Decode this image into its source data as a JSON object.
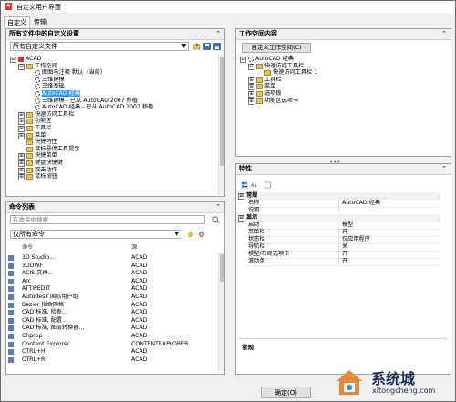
{
  "window": {
    "title": "自定义用户界面"
  },
  "tabs": [
    {
      "label": "自定义"
    },
    {
      "label": "传输"
    }
  ],
  "left_top": {
    "header": "所有文件中的自定义设置",
    "collapse": "⌃",
    "file_dropdown": "所有自定义文件",
    "tree": [
      {
        "label": "ACAD",
        "depth": 0,
        "exp": "⊟",
        "icon": "acad-icon"
      },
      {
        "label": "工作空间",
        "depth": 1,
        "exp": "⊟",
        "icon": "folder-icon"
      },
      {
        "label": "图图与注释 默认（当前）",
        "depth": 2,
        "exp": "",
        "icon": "gear-icon"
      },
      {
        "label": "三维建模",
        "depth": 2,
        "exp": "",
        "icon": "gear-icon"
      },
      {
        "label": "三维基础",
        "depth": 2,
        "exp": "",
        "icon": "gear-icon"
      },
      {
        "label": "AutoCAD 经典",
        "depth": 2,
        "exp": "",
        "icon": "gear-icon",
        "selected": true
      },
      {
        "label": "三维建模 - 已从 AutoCAD 2007 移植",
        "depth": 2,
        "exp": "",
        "icon": "gear-icon"
      },
      {
        "label": "AutoCAD 经典 - 已从 AutoCAD 2007 移植",
        "depth": 2,
        "exp": "",
        "icon": "gear-icon"
      },
      {
        "label": "快速访问工具栏",
        "depth": 1,
        "exp": "⊞",
        "icon": "folder-icon"
      },
      {
        "label": "功能区",
        "depth": 1,
        "exp": "⊞",
        "icon": "folder-icon"
      },
      {
        "label": "工具栏",
        "depth": 1,
        "exp": "⊞",
        "icon": "folder-icon"
      },
      {
        "label": "菜单",
        "depth": 1,
        "exp": "⊞",
        "icon": "folder-icon"
      },
      {
        "label": "快捷特性",
        "depth": 1,
        "exp": "",
        "icon": "folder-icon"
      },
      {
        "label": "鼠标悬停工具提示",
        "depth": 1,
        "exp": "",
        "icon": "folder-icon"
      },
      {
        "label": "快捷菜单",
        "depth": 1,
        "exp": "⊞",
        "icon": "folder-icon"
      },
      {
        "label": "键盘快捷键",
        "depth": 1,
        "exp": "⊞",
        "icon": "folder-icon"
      },
      {
        "label": "双击动作",
        "depth": 1,
        "exp": "⊞",
        "icon": "folder-icon"
      },
      {
        "label": "鼠标按钮",
        "depth": 1,
        "exp": "⊞",
        "icon": "folder-icon"
      }
    ]
  },
  "left_bottom": {
    "header": "命令列表:",
    "collapse": "⌃",
    "search_placeholder": "在命令中搜索",
    "filter_dropdown": "仅所有命令",
    "columns": {
      "command": "命令",
      "source": "源"
    },
    "commands": [
      {
        "name": "3D Studio...",
        "source": "ACAD"
      },
      {
        "name": "3DDWF",
        "source": "ACAD"
      },
      {
        "name": "ACIS 文件...",
        "source": "ACAD"
      },
      {
        "name": "Arc",
        "source": "ACAD"
      },
      {
        "name": "ATTIPEDIT",
        "source": "ACAD"
      },
      {
        "name": "Autodesk 国际用户组",
        "source": "ACAD"
      },
      {
        "name": "Bezier 拟合网格",
        "source": "ACAD"
      },
      {
        "name": "CAD 标准, 检查...",
        "source": "ACAD"
      },
      {
        "name": "CAD 标准, 配置...",
        "source": "ACAD"
      },
      {
        "name": "CAD 标准, 图层转换器...",
        "source": "ACAD"
      },
      {
        "name": "Chprop",
        "source": "ACAD"
      },
      {
        "name": "Content Explorer",
        "source": "CONTENTEXPLORER"
      },
      {
        "name": "CTRL+H",
        "source": "ACAD"
      },
      {
        "name": "CTRL+R",
        "source": "ACAD"
      }
    ]
  },
  "right_top": {
    "header": "工作空间内容",
    "collapse": "⌃",
    "customize_button": "自定义工作空间(C)",
    "tree": [
      {
        "label": "AutoCAD 经典",
        "depth": 0,
        "exp": "⊟",
        "icon": "gear-icon"
      },
      {
        "label": "快速访问工具栏",
        "depth": 1,
        "exp": "⊟",
        "icon": "folder-icon"
      },
      {
        "label": "快速访问工具栏 1",
        "depth": 2,
        "exp": "",
        "icon": "folder-icon"
      },
      {
        "label": "工具栏",
        "depth": 1,
        "exp": "⊞",
        "icon": "folder-icon"
      },
      {
        "label": "菜单",
        "depth": 1,
        "exp": "⊞",
        "icon": "folder-icon"
      },
      {
        "label": "选项板",
        "depth": 1,
        "exp": "⊞",
        "icon": "folder-icon"
      },
      {
        "label": "功能区选项卡",
        "depth": 1,
        "exp": "⊞",
        "icon": "folder-icon"
      }
    ],
    "splitter": "•••"
  },
  "right_bottom": {
    "header": "特性",
    "collapse": "⌃",
    "categories": [
      {
        "name": "常规",
        "props": [
          {
            "k": "名称",
            "v": "AutoCAD 经典"
          },
          {
            "k": "说明",
            "v": ""
          }
        ]
      },
      {
        "name": "显示",
        "props": [
          {
            "k": "启动",
            "v": "模型"
          },
          {
            "k": "菜单栏",
            "v": "开"
          },
          {
            "k": "状态栏",
            "v": "仅应用程序"
          },
          {
            "k": "导航栏",
            "v": "关"
          },
          {
            "k": "模型/布局选项卡",
            "v": "开"
          },
          {
            "k": "滚动条",
            "v": "开"
          }
        ]
      }
    ],
    "desc_title": "常规"
  },
  "footer": {
    "ok": "确定(O)"
  },
  "watermark": {
    "brand": "系统城",
    "site": "xitongcheng.com"
  }
}
